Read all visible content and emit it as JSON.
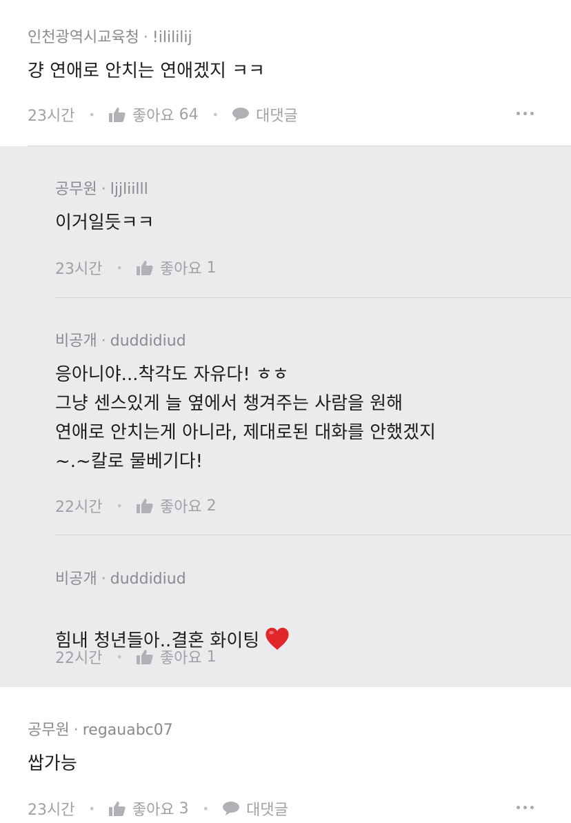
{
  "comments": [
    {
      "author": "인천광역시교육청",
      "user": "!ilililij",
      "text": "걍 연애로 안치는 연애겠지 ㅋㅋ",
      "time": "23시간",
      "like_label": "좋아요",
      "like_count": "64",
      "reply_label": "대댓글"
    },
    {
      "author": "공무원",
      "user": "regauabc07",
      "text": "쌉가능",
      "time": "23시간",
      "like_label": "좋아요",
      "like_count": "3",
      "reply_label": "대댓글"
    }
  ],
  "replies": [
    {
      "author": "공무원",
      "user": "ljjliilll",
      "text": "이거일듯ㅋㅋ",
      "time": "23시간",
      "like_label": "좋아요",
      "like_count": "1"
    },
    {
      "author": "비공개",
      "user": "duddidiud",
      "text": "응아니야...착각도 자유다! ㅎㅎ\n그냥 센스있게 늘 옆에서 챙겨주는 사람을 원해\n연애로 안치는게 아니라, 제대로된 대화를 안했겠지\n~.~칼로 물베기다!",
      "time": "22시간",
      "like_label": "좋아요",
      "like_count": "2"
    },
    {
      "author": "비공개",
      "user": "duddidiud",
      "text": "힘내 청년들아..결혼 화이팅",
      "time": "22시간",
      "like_label": "좋아요",
      "like_count": "1"
    }
  ],
  "colors": {
    "reply_background": "#ebebed",
    "heart": "#e0262b"
  }
}
